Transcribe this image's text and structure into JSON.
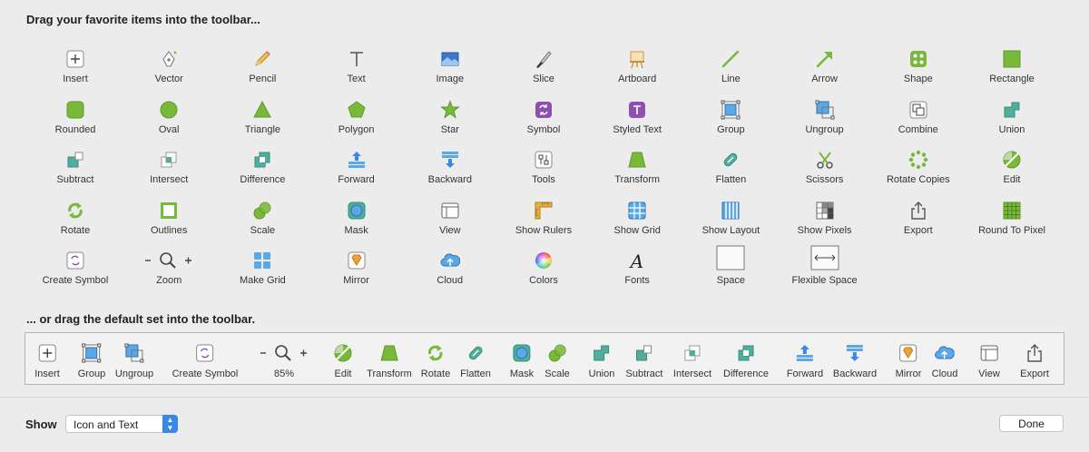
{
  "heading_favorites": "Drag your favorite items into the toolbar...",
  "heading_default": "... or drag the default set into the toolbar.",
  "palette_rows": [
    [
      {
        "label": "Insert",
        "icon": "insert-icon"
      },
      {
        "label": "Vector",
        "icon": "vector-pen-icon"
      },
      {
        "label": "Pencil",
        "icon": "pencil-icon"
      },
      {
        "label": "Text",
        "icon": "text-icon"
      },
      {
        "label": "Image",
        "icon": "image-icon"
      },
      {
        "label": "Slice",
        "icon": "slice-knife-icon"
      },
      {
        "label": "Artboard",
        "icon": "artboard-easel-icon"
      },
      {
        "label": "Line",
        "icon": "line-icon"
      },
      {
        "label": "Arrow",
        "icon": "arrow-icon"
      },
      {
        "label": "Shape",
        "icon": "shape-icon"
      },
      {
        "label": "Rectangle",
        "icon": "rectangle-icon"
      }
    ],
    [
      {
        "label": "Rounded",
        "icon": "rounded-rectangle-icon"
      },
      {
        "label": "Oval",
        "icon": "oval-icon"
      },
      {
        "label": "Triangle",
        "icon": "triangle-icon"
      },
      {
        "label": "Polygon",
        "icon": "polygon-icon"
      },
      {
        "label": "Star",
        "icon": "star-icon"
      },
      {
        "label": "Symbol",
        "icon": "symbol-icon"
      },
      {
        "label": "Styled Text",
        "icon": "styled-text-icon"
      },
      {
        "label": "Group",
        "icon": "group-icon"
      },
      {
        "label": "Ungroup",
        "icon": "ungroup-icon"
      },
      {
        "label": "Combine",
        "icon": "combine-icon"
      },
      {
        "label": "Union",
        "icon": "union-icon"
      }
    ],
    [
      {
        "label": "Subtract",
        "icon": "subtract-icon"
      },
      {
        "label": "Intersect",
        "icon": "intersect-icon"
      },
      {
        "label": "Difference",
        "icon": "difference-icon"
      },
      {
        "label": "Forward",
        "icon": "forward-icon"
      },
      {
        "label": "Backward",
        "icon": "backward-icon"
      },
      {
        "label": "Tools",
        "icon": "tools-icon"
      },
      {
        "label": "Transform",
        "icon": "transform-icon"
      },
      {
        "label": "Flatten",
        "icon": "flatten-icon"
      },
      {
        "label": "Scissors",
        "icon": "scissors-icon"
      },
      {
        "label": "Rotate Copies",
        "icon": "rotate-copies-icon"
      },
      {
        "label": "Edit",
        "icon": "edit-icon"
      }
    ],
    [
      {
        "label": "Rotate",
        "icon": "rotate-icon"
      },
      {
        "label": "Outlines",
        "icon": "outlines-icon"
      },
      {
        "label": "Scale",
        "icon": "scale-icon"
      },
      {
        "label": "Mask",
        "icon": "mask-icon"
      },
      {
        "label": "View",
        "icon": "view-icon"
      },
      {
        "label": "Show Rulers",
        "icon": "rulers-icon"
      },
      {
        "label": "Show Grid",
        "icon": "grid-icon"
      },
      {
        "label": "Show Layout",
        "icon": "layout-icon"
      },
      {
        "label": "Show Pixels",
        "icon": "pixels-icon"
      },
      {
        "label": "Export",
        "icon": "export-icon"
      },
      {
        "label": "Round To Pixel",
        "icon": "round-to-pixel-icon"
      }
    ],
    [
      {
        "label": "Create Symbol",
        "icon": "create-symbol-icon"
      },
      {
        "label": "Zoom",
        "icon": "zoom-icon"
      },
      {
        "label": "Make Grid",
        "icon": "make-grid-icon"
      },
      {
        "label": "Mirror",
        "icon": "mirror-icon"
      },
      {
        "label": "Cloud",
        "icon": "cloud-icon"
      },
      {
        "label": "Colors",
        "icon": "colors-icon"
      },
      {
        "label": "Fonts",
        "icon": "fonts-icon"
      },
      {
        "label": "Space",
        "icon": "space-icon"
      },
      {
        "label": "Flexible Space",
        "icon": "flexible-space-icon"
      }
    ]
  ],
  "default_set": [
    {
      "label": "Insert",
      "icon": "insert-icon"
    },
    {
      "label": "Group",
      "icon": "group-icon"
    },
    {
      "label": "Ungroup",
      "icon": "ungroup-icon"
    },
    {
      "label": "Create Symbol",
      "icon": "create-symbol-icon"
    },
    {
      "label": "85%",
      "icon": "zoom-icon"
    },
    {
      "label": "Edit",
      "icon": "edit-icon"
    },
    {
      "label": "Transform",
      "icon": "transform-icon"
    },
    {
      "label": "Rotate",
      "icon": "rotate-icon"
    },
    {
      "label": "Flatten",
      "icon": "flatten-icon"
    },
    {
      "label": "Mask",
      "icon": "mask-icon"
    },
    {
      "label": "Scale",
      "icon": "scale-icon"
    },
    {
      "label": "Union",
      "icon": "union-icon"
    },
    {
      "label": "Subtract",
      "icon": "subtract-icon"
    },
    {
      "label": "Intersect",
      "icon": "intersect-icon"
    },
    {
      "label": "Difference",
      "icon": "difference-icon"
    },
    {
      "label": "Forward",
      "icon": "forward-icon"
    },
    {
      "label": "Backward",
      "icon": "backward-icon"
    },
    {
      "label": "Mirror",
      "icon": "mirror-icon"
    },
    {
      "label": "Cloud",
      "icon": "cloud-icon"
    },
    {
      "label": "View",
      "icon": "view-icon"
    },
    {
      "label": "Export",
      "icon": "export-icon"
    }
  ],
  "footer": {
    "show_label": "Show",
    "display_mode": "Icon and Text",
    "done_label": "Done"
  },
  "colors": {
    "green": "#7ab83a",
    "teal": "#4fae9c",
    "blue": "#3b87e8",
    "purple": "#8e4fb0",
    "orange": "#f0a23a"
  }
}
